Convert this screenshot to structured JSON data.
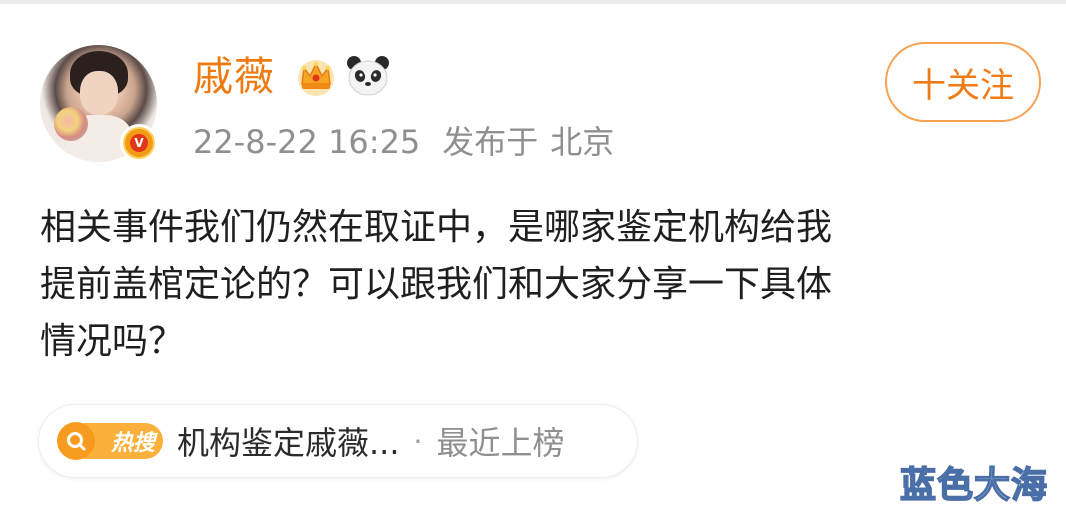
{
  "post": {
    "author": {
      "name": "戚薇",
      "avatar_icon": "user-avatar",
      "verified_icon": "verified-v-icon",
      "badges": [
        "crown-icon",
        "panda-icon"
      ]
    },
    "follow_label": "十关注",
    "timestamp": "22-8-22 16:25",
    "location_prefix": "发布于",
    "location": "北京",
    "content_lines": [
      "相关事件我们仍然在取证中，是哪家鉴定机构给我",
      "提前盖棺定论的？可以跟我们和大家分享一下具体",
      "情况吗？"
    ]
  },
  "hot_search": {
    "badge_label": "热搜",
    "title": "机构鉴定戚薇...",
    "separator": "·",
    "status": "最近上榜"
  },
  "watermark": "蓝色大海",
  "colors": {
    "accent_orange": "#ee7a10",
    "follow_border": "#f7a151",
    "meta_gray": "#8f8f8f",
    "text_dark": "#1f1f1f",
    "hot_badge": "#fbb03b"
  }
}
